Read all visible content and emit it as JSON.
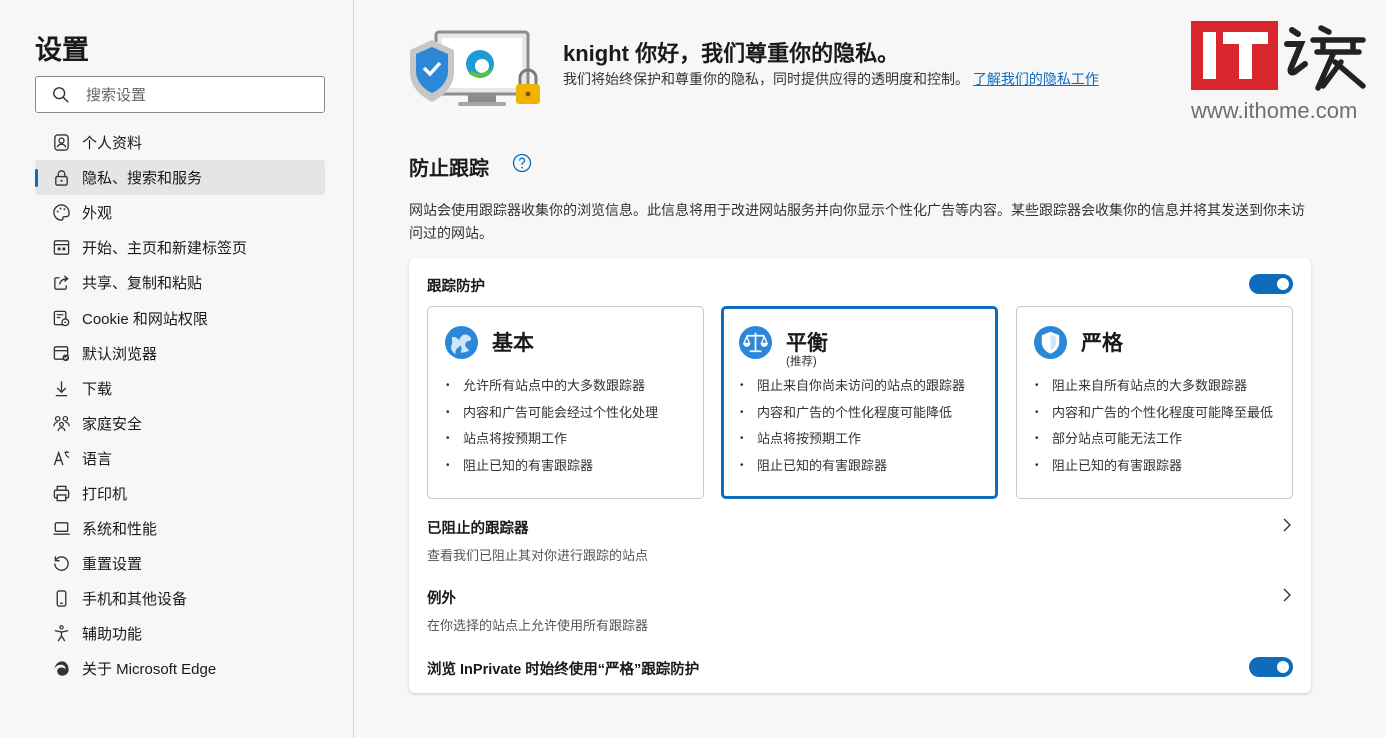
{
  "sidebar": {
    "title": "设置",
    "search_placeholder": "搜索设置",
    "items": [
      {
        "label": "个人资料",
        "icon": "profile-icon"
      },
      {
        "label": "隐私、搜索和服务",
        "icon": "lock-icon",
        "active": true
      },
      {
        "label": "外观",
        "icon": "palette-icon"
      },
      {
        "label": "开始、主页和新建标签页",
        "icon": "home-tab-icon"
      },
      {
        "label": "共享、复制和粘贴",
        "icon": "share-icon"
      },
      {
        "label": "Cookie 和网站权限",
        "icon": "cookie-icon"
      },
      {
        "label": "默认浏览器",
        "icon": "browser-icon"
      },
      {
        "label": "下载",
        "icon": "download-icon"
      },
      {
        "label": "家庭安全",
        "icon": "family-icon"
      },
      {
        "label": "语言",
        "icon": "language-icon"
      },
      {
        "label": "打印机",
        "icon": "printer-icon"
      },
      {
        "label": "系统和性能",
        "icon": "laptop-icon"
      },
      {
        "label": "重置设置",
        "icon": "reset-icon"
      },
      {
        "label": "手机和其他设备",
        "icon": "phone-icon"
      },
      {
        "label": "辅助功能",
        "icon": "accessibility-icon"
      },
      {
        "label": "关于 Microsoft Edge",
        "icon": "edge-icon"
      }
    ]
  },
  "hero": {
    "title": "knight 你好，我们尊重你的隐私。",
    "desc": "我们将始终保护和尊重你的隐私，同时提供应得的透明度和控制。",
    "link": "了解我们的隐私工作"
  },
  "watermark": {
    "brand": "IT之家",
    "url": "www.ithome.com"
  },
  "tracking": {
    "title": "防止跟踪",
    "desc": "网站会使用跟踪器收集你的浏览信息。此信息将用于改进网站服务并向你显示个性化广告等内容。某些跟踪器会收集你的信息并将其发送到你未访问过的网站。",
    "protection_label": "跟踪防护",
    "protection_on": true,
    "options": [
      {
        "title": "基本",
        "subtitle": "",
        "icon": "globe-icon",
        "selected": false,
        "bullets": [
          "允许所有站点中的大多数跟踪器",
          "内容和广告可能会经过个性化处理",
          "站点将按预期工作",
          "阻止已知的有害跟踪器"
        ]
      },
      {
        "title": "平衡",
        "subtitle": "(推荐)",
        "icon": "scales-icon",
        "selected": true,
        "bullets": [
          "阻止来自你尚未访问的站点的跟踪器",
          "内容和广告的个性化程度可能降低",
          "站点将按预期工作",
          "阻止已知的有害跟踪器"
        ]
      },
      {
        "title": "严格",
        "subtitle": "",
        "icon": "shield-icon",
        "selected": false,
        "bullets": [
          "阻止来自所有站点的大多数跟踪器",
          "内容和广告的个性化程度可能降至最低",
          "部分站点可能无法工作",
          "阻止已知的有害跟踪器"
        ]
      }
    ],
    "blocked_label": "已阻止的跟踪器",
    "blocked_sub": "查看我们已阻止其对你进行跟踪的站点",
    "exceptions_label": "例外",
    "exceptions_sub": "在你选择的站点上允许使用所有跟踪器",
    "inprivate_label": "浏览 InPrivate 时始终使用“严格”跟踪防护",
    "inprivate_on": true
  },
  "colors": {
    "accent": "#0f6cbd",
    "watermark_red": "#d9262c"
  }
}
